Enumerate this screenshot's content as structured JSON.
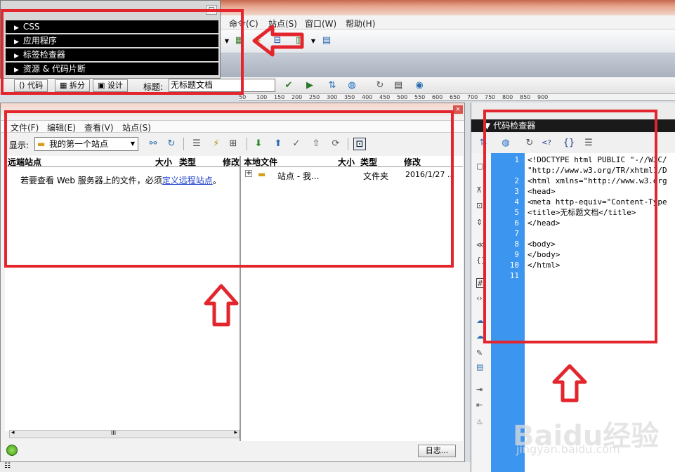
{
  "menubar": {
    "items": [
      "命令(C)",
      "站点(S)",
      "窗口(W)",
      "帮助(H)"
    ]
  },
  "panel_menu": {
    "items": [
      "CSS",
      "应用程序",
      "标签检查器",
      "资源 & 代码片断"
    ]
  },
  "doc_toolbar": {
    "code_label": "代码",
    "split_label": "拆分",
    "design_label": "设计",
    "title_label": "标题:",
    "title_value": "无标题文档"
  },
  "ruler": {
    "ticks": [
      "50",
      "100",
      "150",
      "200",
      "250",
      "300",
      "350",
      "400",
      "450",
      "500",
      "550",
      "600",
      "650",
      "700",
      "750",
      "800",
      "850",
      "900"
    ]
  },
  "files_panel": {
    "menu": [
      "文件(F)",
      "编辑(E)",
      "查看(V)",
      "站点(S)"
    ],
    "show_label": "显示:",
    "site_select": "我的第一个站点",
    "remote_headers": [
      "远端站点",
      "大小",
      "类型",
      "修改"
    ],
    "local_headers": [
      "本地文件",
      "大小",
      "类型",
      "修改"
    ],
    "remote_message_prefix": "若要查看 Web 服务器上的文件，必须",
    "remote_message_link": "定义远程站点",
    "remote_message_suffix": "。",
    "local_row": {
      "name": "站点 - 我...",
      "type": "文件夹",
      "modified": "2016/1/27 ..."
    },
    "log_button": "日志...",
    "scroll_marker": "III"
  },
  "code_inspector": {
    "title": "代码检查器",
    "line_numbers": [
      "1",
      "",
      "2",
      "3",
      "4",
      "5",
      "6",
      "7",
      "8",
      "9",
      "10",
      "11"
    ],
    "code": "<!DOCTYPE html PUBLIC \"-//W3C/\n\"http://www.w3.org/TR/xhtml1/D\n<html xmlns=\"http://www.w3.org\n<head>\n<meta http-equiv=\"Content-Type\n<title>无标题文档</title>\n</head>\n\n<body>\n</body>\n</html>\n"
  },
  "watermark": {
    "brand": "Baidu经验",
    "url": "jingyan.baidu.com"
  },
  "colors": {
    "annotation_red": "#e3262d",
    "gutter_blue": "#3c95ee",
    "title_black": "#000000"
  }
}
